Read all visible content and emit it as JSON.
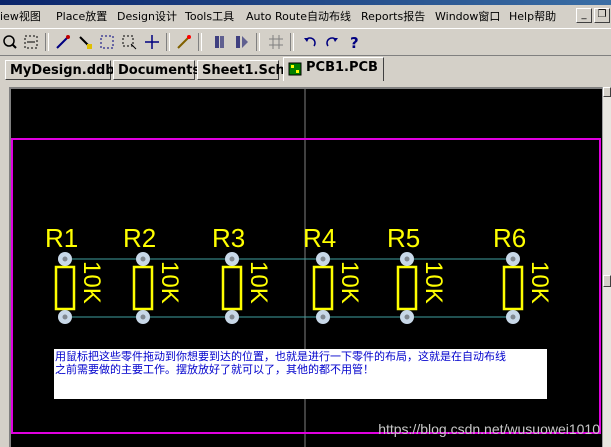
{
  "menu": {
    "items": [
      "iew视图",
      "Place放置",
      "Design设计",
      "Tools工具",
      "Auto Route自动布线",
      "Reports报告",
      "Window窗口",
      "Help帮助"
    ]
  },
  "window_buttons": {
    "minimize": "_",
    "restore": "❐"
  },
  "toolbar": {
    "icons": [
      "zoom-icon",
      "zoom-area-icon",
      "wire-cut-icon",
      "highlight-icon",
      "select-area-icon",
      "move-icon",
      "cross-icon",
      "magic-icon",
      "library-icon",
      "browse-library-icon",
      "grid-icon",
      "undo-icon",
      "redo-icon",
      "help-icon"
    ]
  },
  "tabs": [
    {
      "label": "MyDesign.ddb",
      "active": false
    },
    {
      "label": "Documents",
      "active": false
    },
    {
      "label": "Sheet1.Sch",
      "active": false
    },
    {
      "label": "PCB1.PCB",
      "active": true
    }
  ],
  "pcb": {
    "components": [
      {
        "designator": "R1",
        "value": "10K"
      },
      {
        "designator": "R2",
        "value": "10K"
      },
      {
        "designator": "R3",
        "value": "10K"
      },
      {
        "designator": "R4",
        "value": "10K"
      },
      {
        "designator": "R5",
        "value": "10K"
      },
      {
        "designator": "R6",
        "value": "10K"
      }
    ],
    "note_lines": [
      "用鼠标把这些零件拖动到你想要到达的位置，也就是进行一下零件的布局，这就是在自动布线",
      "之前需要做的主要工作。摆放放好了就可以了，其他的都不用管！"
    ],
    "colors": {
      "background": "#000000",
      "board_outline": "#e000e0",
      "silkscreen": "#ffff00",
      "pads": "#c8d8e8",
      "ratsnest": "#40a0a0"
    }
  },
  "watermark": "https://blog.csdn.net/wusuowei1010"
}
